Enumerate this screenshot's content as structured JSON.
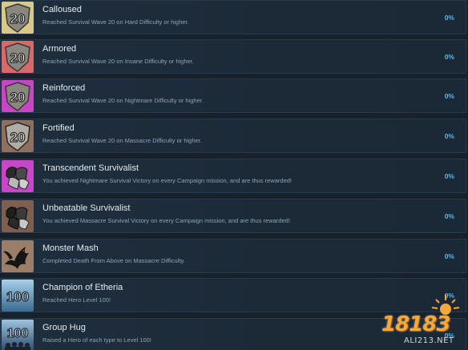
{
  "achievements": [
    {
      "title": "Calloused",
      "description": "Reached Survival Wave 20 on Hard Difficulty or higher.",
      "percent": "0%",
      "badge_text": "20",
      "badge_icon": "shield-20-icon",
      "badge_color": "#c8b870"
    },
    {
      "title": "Armored",
      "description": "Reached Survival Wave 20 on Insane Difficulty or higher.",
      "percent": "0%",
      "badge_text": "20",
      "badge_icon": "shield-20-icon",
      "badge_color": "#c85a5a"
    },
    {
      "title": "Reinforced",
      "description": "Reached Survival Wave 20 on Nightmare Difficulty or higher.",
      "percent": "0%",
      "badge_text": "20",
      "badge_icon": "shield-20-icon",
      "badge_color": "#c040c0"
    },
    {
      "title": "Fortified",
      "description": "Reached Survival Wave 20 on Massacre Difficulty or higher.",
      "percent": "0%",
      "badge_text": "20",
      "badge_icon": "shield-20-icon",
      "badge_color": "#8a6a5a"
    },
    {
      "title": "Transcendent Survivalist",
      "description": "You achieved Nightmare Survival Victory on every Campaign mission, and are thus rewarded!",
      "percent": "0%",
      "badge_text": "",
      "badge_icon": "armor-pieces-icon",
      "badge_color": "#c040c0"
    },
    {
      "title": "Unbeatable Survivalist",
      "description": "You achieved Massacre Survival Victory on every Campaign mission, and are thus rewarded!",
      "percent": "0%",
      "badge_text": "",
      "badge_icon": "armor-pieces-icon",
      "badge_color": "#7a5a4a"
    },
    {
      "title": "Monster Mash",
      "description": "Completed Death From Above on Massacre Difficulty.",
      "percent": "0%",
      "badge_text": "",
      "badge_icon": "dragon-icon",
      "badge_color": "#8a7060"
    },
    {
      "title": "Champion of Etheria",
      "description": "Reached Hero Level 100!",
      "percent": "0%",
      "badge_text": "100",
      "badge_icon": "level-100-icon",
      "badge_color": "#6a9ab8"
    },
    {
      "title": "Group Hug",
      "description": "Raised a Hero of each type to Level 100!",
      "percent": "0%",
      "badge_text": "100",
      "badge_icon": "level-100-group-icon",
      "badge_color": "#5a7a98"
    }
  ],
  "watermark": {
    "logo_text": "18183",
    "sub_text": "ALI213.NET"
  }
}
